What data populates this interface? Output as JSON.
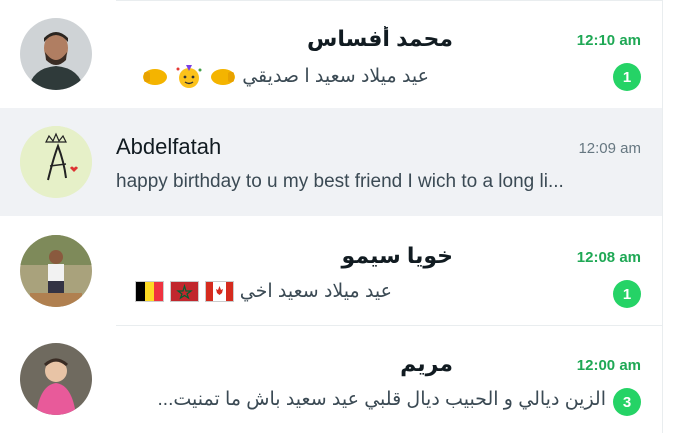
{
  "chats": [
    {
      "name": "محمد أفساس",
      "time": "12:10 am",
      "unread": 1,
      "preview": "عيد ميلاد سعيد ا صديقي",
      "emojis": [
        "fist-bump-emoji",
        "party-face-emoji",
        "fist-bump-emoji"
      ],
      "avatar": "avatar-man-dark"
    },
    {
      "name": "Abdelfatah",
      "time": "12:09 am",
      "unread": null,
      "preview": "happy birthday to u my best friend   I wich to a long li...",
      "avatar": "avatar-letter-a-crown"
    },
    {
      "name": "خويا سيمو",
      "time": "12:08 am",
      "unread": 1,
      "preview": "عيد ميلاد سعيد  اخي",
      "flags": [
        "belgium-flag",
        "morocco-flag",
        "canada-flag"
      ],
      "avatar": "avatar-man-outdoor"
    },
    {
      "name": "مريم",
      "time": "12:00 am",
      "unread": 3,
      "preview": "الزين ديالي و الحبيب ديال قلبي عيد سعيد باش ما تمنيت...",
      "avatar": "avatar-baby"
    }
  ],
  "colors": {
    "unread_accent": "#25d366",
    "unread_time": "#1fa855",
    "selected_bg": "#f0f2f5"
  }
}
